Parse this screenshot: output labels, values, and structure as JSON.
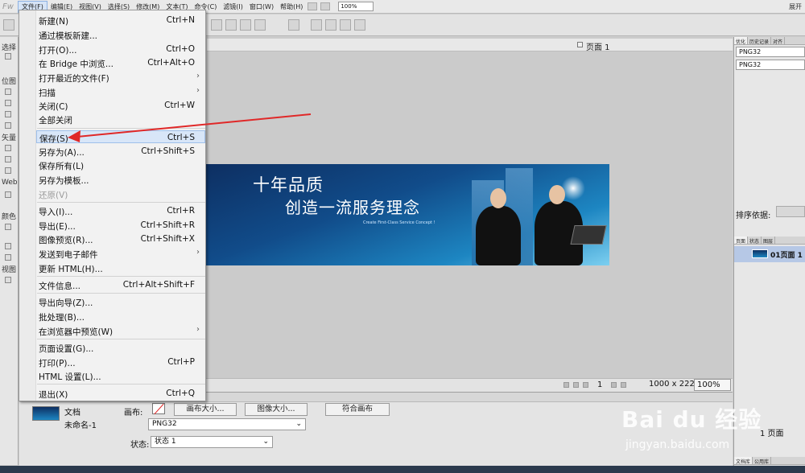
{
  "app": {
    "logo": "Fw"
  },
  "menubar": {
    "items": [
      "文件(F)",
      "编辑(E)",
      "视图(V)",
      "选择(S)",
      "修改(M)",
      "文本(T)",
      "命令(C)",
      "滤镜(I)",
      "窗口(W)",
      "帮助(H)"
    ],
    "zoom": "100%",
    "expand": "展开"
  },
  "file_menu": {
    "items": [
      {
        "label": "新建(N)",
        "shortcut": "Ctrl+N"
      },
      {
        "label": "通过模板新建...",
        "shortcut": ""
      },
      {
        "label": "打开(O)...",
        "shortcut": "Ctrl+O"
      },
      {
        "label": "在 Bridge 中浏览...",
        "shortcut": "Ctrl+Alt+O"
      },
      {
        "label": "打开最近的文件(F)",
        "shortcut": "",
        "submenu": "›"
      },
      {
        "label": "扫描",
        "shortcut": "",
        "submenu": "›"
      },
      {
        "label": "关闭(C)",
        "shortcut": "Ctrl+W"
      },
      {
        "label": "全部关闭",
        "shortcut": ""
      },
      {
        "label": "保存(S)",
        "shortcut": "Ctrl+S"
      },
      {
        "label": "另存为(A)...",
        "shortcut": "Ctrl+Shift+S"
      },
      {
        "label": "保存所有(L)",
        "shortcut": ""
      },
      {
        "label": "另存为模板...",
        "shortcut": ""
      },
      {
        "label": "还原(V)",
        "shortcut": ""
      },
      {
        "label": "导入(I)...",
        "shortcut": "Ctrl+R"
      },
      {
        "label": "导出(E)...",
        "shortcut": "Ctrl+Shift+R"
      },
      {
        "label": "图像预览(R)...",
        "shortcut": "Ctrl+Shift+X"
      },
      {
        "label": "发送到电子邮件",
        "shortcut": "",
        "submenu": "›"
      },
      {
        "label": "更新 HTML(H)...",
        "shortcut": ""
      },
      {
        "label": "文件信息...",
        "shortcut": "Ctrl+Alt+Shift+F"
      },
      {
        "label": "导出向导(Z)...",
        "shortcut": ""
      },
      {
        "label": "批处理(B)...",
        "shortcut": ""
      },
      {
        "label": "在浏览器中预览(W)",
        "shortcut": "",
        "submenu": "›"
      },
      {
        "label": "页面设置(G)...",
        "shortcut": ""
      },
      {
        "label": "打印(P)...",
        "shortcut": "Ctrl+P"
      },
      {
        "label": "HTML 设置(L)...",
        "shortcut": ""
      },
      {
        "label": "退出(X)",
        "shortcut": "Ctrl+Q"
      }
    ]
  },
  "tools_panel": {
    "sections": [
      "选择",
      "位图",
      "矢量",
      "Web",
      "颜色",
      "视图"
    ]
  },
  "document": {
    "page_label": "页面 1",
    "banner": {
      "title1": "十年品质",
      "title2": "创造一流服务理念",
      "subtitle": "Create First-Class Service Concept !"
    }
  },
  "status_bar": {
    "page": "1",
    "size": "1000 x 222",
    "zoom": "100%"
  },
  "properties": {
    "doc_label": "文档",
    "doc_name": "未命名-1",
    "canvas_label": "画布:",
    "canvas_size_btn": "画布大小...",
    "image_size_btn": "图像大小...",
    "fit_canvas_btn": "符合画布",
    "format": "PNG32",
    "state_label": "状态:",
    "state": "状态 1"
  },
  "right_panel": {
    "tabs_top": [
      "优化",
      "历史记录",
      "对齐"
    ],
    "optimize_preset": "PNG32",
    "optimize_format": "PNG32",
    "sort_label": "排序依据:",
    "tabs_pages": [
      "页面",
      "状态",
      "图层"
    ],
    "page_item": "01页面 1",
    "page_count": "1 页面",
    "tabs_bottom": [
      "文档库",
      "公用库"
    ]
  },
  "watermark": {
    "brand": "Bai du 经验",
    "url": "jingyan.baidu.com"
  }
}
